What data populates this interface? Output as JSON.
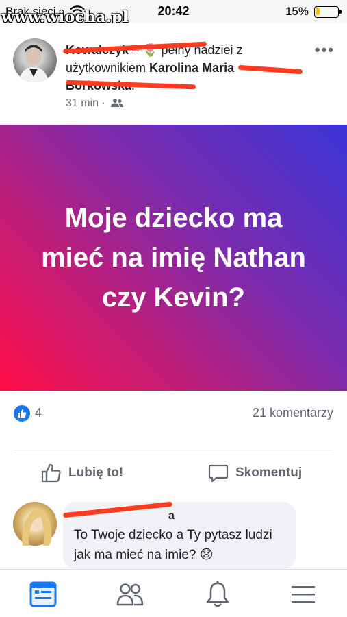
{
  "status_bar": {
    "carrier": "Brak sieci",
    "time": "20:42",
    "battery_percent": "15%",
    "battery_level": 0.15
  },
  "watermark": "www.wiocha.pl",
  "post": {
    "author_name": "Kowalczyk",
    "feeling_prefix": " – ",
    "feeling_emoji": "🌷",
    "feeling_text": " pełny nadziei z użytkownikiem ",
    "tagged_user": "Karolina Maria Borkowska",
    "tagged_suffix": ".",
    "time": "31 min",
    "meta_separator": " · ",
    "audience_icon": "friends-icon",
    "more_icon": "more-icon"
  },
  "card": {
    "text": "Moje dziecko ma mieć na imię Nathan czy Kevin?",
    "gradient_start": "#ff0e48",
    "gradient_end": "#3b35d8"
  },
  "reactions": {
    "like_count": "4",
    "comments_count": "21 komentarzy",
    "like_color": "#1877f2"
  },
  "actions": {
    "like_label": "Lubię to!",
    "comment_label": "Skomentuj"
  },
  "comment": {
    "author_name": "a",
    "text": "To Twoje dziecko a Ty pytasz ludzi jak ma mieć na imie? 😧"
  },
  "bottom_nav": {
    "items": [
      "feed-icon",
      "friends-icon",
      "notifications-icon",
      "menu-icon"
    ],
    "active_color": "#1877f2"
  }
}
